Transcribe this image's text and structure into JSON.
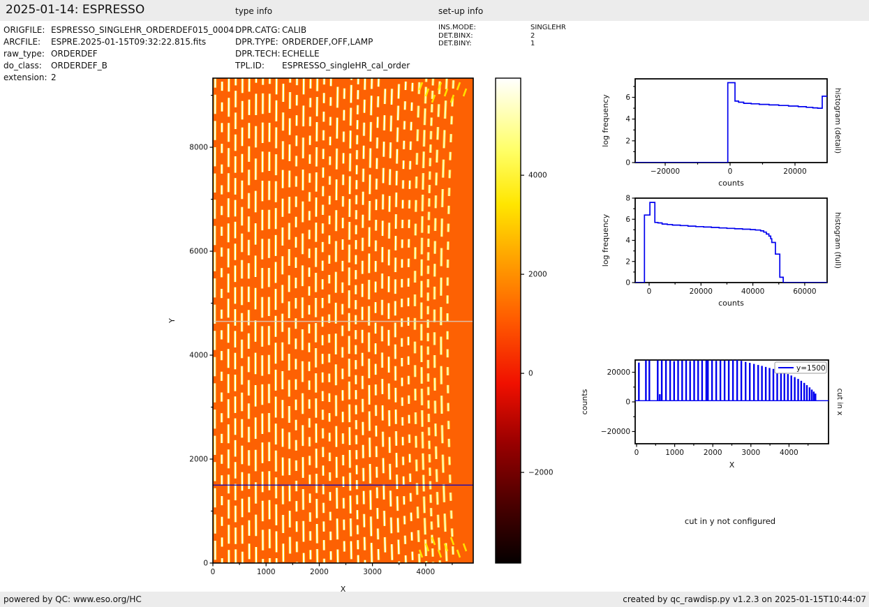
{
  "header": {
    "title": "2025-01-14: ESPRESSO",
    "type_info_label": "type info",
    "setup_info_label": "set-up info"
  },
  "metadata": {
    "rows": [
      {
        "label": "ORIGFILE:",
        "value": "ESPRESSO_SINGLEHR_ORDERDEF015_0004"
      },
      {
        "label": "ARCFILE:",
        "value": "ESPRE.2025-01-15T09:32:22.815.fits"
      },
      {
        "label": "raw_type:",
        "value": "ORDERDEF"
      },
      {
        "label": "do_class:",
        "value": "ORDERDEF_B"
      },
      {
        "label": "extension:",
        "value": "2"
      }
    ]
  },
  "type_info": {
    "rows": [
      {
        "label": "DPR.CATG:",
        "value": "CALIB"
      },
      {
        "label": "DPR.TYPE:",
        "value": "ORDERDEF,OFF,LAMP"
      },
      {
        "label": "DPR.TECH:",
        "value": "ECHELLE"
      },
      {
        "label": "TPL.ID:",
        "value": "ESPRESSO_singleHR_cal_order"
      }
    ]
  },
  "setup_info": {
    "rows": [
      {
        "label": "INS.MODE:",
        "value": "SINGLEHR"
      },
      {
        "label": "DET.BINX:",
        "value": "2"
      },
      {
        "label": "DET.BINY:",
        "value": "1"
      }
    ]
  },
  "notes": {
    "cut_in_y": "cut in y not configured"
  },
  "footer": {
    "left": "powered by QC: www.eso.org/HC",
    "right": "created by qc_rawdisp.py v1.2.3 on 2025-01-15T10:44:07"
  },
  "chart_data": [
    {
      "id": "main_image",
      "type": "heatmap",
      "xlabel": "X",
      "ylabel": "Y",
      "xlim": [
        0,
        4895
      ],
      "ylim": [
        0,
        9330
      ],
      "xticks": [
        {
          "v": 0,
          "l": "0"
        },
        {
          "v": 500
        },
        {
          "v": 1000,
          "l": "1000"
        },
        {
          "v": 1500
        },
        {
          "v": 2000,
          "l": "2000"
        },
        {
          "v": 2500
        },
        {
          "v": 3000,
          "l": "3000"
        },
        {
          "v": 3500
        },
        {
          "v": 4000,
          "l": "4000"
        },
        {
          "v": 4500
        }
      ],
      "yticks": [
        {
          "v": 0,
          "l": "0"
        },
        {
          "v": 1000
        },
        {
          "v": 2000,
          "l": "2000"
        },
        {
          "v": 3000
        },
        {
          "v": 4000,
          "l": "4000"
        },
        {
          "v": 5000
        },
        {
          "v": 6000,
          "l": "6000"
        },
        {
          "v": 7000
        },
        {
          "v": 8000,
          "l": "8000"
        },
        {
          "v": 9000
        }
      ],
      "bg_color": "#fd6103",
      "stripe_color": "#ffffff",
      "stripe_glow": "#ffd700",
      "stripe_count": 36,
      "stripe_x0": 45,
      "stripe_dx": 128,
      "cut_line_y": 1500,
      "cut_color": "#0000c8",
      "gap_line_y": 4650
    },
    {
      "id": "colorbar",
      "type": "colorbar",
      "vmin": -3830,
      "vmax": 5960,
      "ticks": [
        {
          "v": 4000,
          "l": "4000"
        },
        {
          "v": 2000,
          "l": "2000"
        },
        {
          "v": 0,
          "l": "0"
        },
        {
          "v": -2000,
          "l": "−2000"
        }
      ],
      "stops": [
        {
          "t": 0,
          "c": "#050000"
        },
        {
          "t": 0.12,
          "c": "#4a0000"
        },
        {
          "t": 0.25,
          "c": "#9b0000"
        },
        {
          "t": 0.37,
          "c": "#f01000"
        },
        {
          "t": 0.5,
          "c": "#ff5a00"
        },
        {
          "t": 0.62,
          "c": "#ff9e00"
        },
        {
          "t": 0.74,
          "c": "#ffe600"
        },
        {
          "t": 0.85,
          "c": "#ffff66"
        },
        {
          "t": 1,
          "c": "#ffffff"
        }
      ]
    },
    {
      "id": "hist_detail",
      "type": "step",
      "xlabel": "counts",
      "ylabel": "log frequency",
      "right_label": "histogram (detail)",
      "line_color": "#0000ee",
      "xlim": [
        -29250,
        29900
      ],
      "ylim": [
        0,
        7.7
      ],
      "xticks": [
        {
          "v": -20000,
          "l": "−20000"
        },
        {
          "v": -10000
        },
        {
          "v": 0,
          "l": "0"
        },
        {
          "v": 10000
        },
        {
          "v": 20000,
          "l": "20000"
        }
      ],
      "yticks": [
        {
          "v": 0,
          "l": "0"
        },
        {
          "v": 1
        },
        {
          "v": 2,
          "l": "2"
        },
        {
          "v": 3
        },
        {
          "v": 4,
          "l": "4"
        },
        {
          "v": 5
        },
        {
          "v": 6,
          "l": "6"
        },
        {
          "v": 7
        }
      ],
      "points": [
        [
          -29250,
          0
        ],
        [
          -700,
          0
        ],
        [
          -700,
          7.35
        ],
        [
          1500,
          7.35
        ],
        [
          1500,
          5.65
        ],
        [
          2600,
          5.55
        ],
        [
          4200,
          5.45
        ],
        [
          6500,
          5.4
        ],
        [
          9000,
          5.35
        ],
        [
          12000,
          5.3
        ],
        [
          15000,
          5.25
        ],
        [
          18000,
          5.2
        ],
        [
          21000,
          5.14
        ],
        [
          23500,
          5.08
        ],
        [
          25500,
          5.03
        ],
        [
          27000,
          5.0
        ],
        [
          28400,
          5.0
        ],
        [
          28400,
          6.1
        ],
        [
          29900,
          6.1
        ]
      ]
    },
    {
      "id": "hist_full",
      "type": "step",
      "xlabel": "counts",
      "ylabel": "log frequency",
      "right_label": "histogram (full)",
      "line_color": "#0000ee",
      "xlim": [
        -5380,
        68640
      ],
      "ylim": [
        0,
        8
      ],
      "xticks": [
        {
          "v": 0,
          "l": "0"
        },
        {
          "v": 10000
        },
        {
          "v": 20000,
          "l": "20000"
        },
        {
          "v": 30000
        },
        {
          "v": 40000,
          "l": "40000"
        },
        {
          "v": 50000
        },
        {
          "v": 60000,
          "l": "60000"
        }
      ],
      "yticks": [
        {
          "v": 0,
          "l": "0"
        },
        {
          "v": 1
        },
        {
          "v": 2,
          "l": "2"
        },
        {
          "v": 3
        },
        {
          "v": 4,
          "l": "4"
        },
        {
          "v": 5
        },
        {
          "v": 6,
          "l": "6"
        },
        {
          "v": 7
        },
        {
          "v": 8,
          "l": "8"
        }
      ],
      "points": [
        [
          -5380,
          0
        ],
        [
          -1800,
          0
        ],
        [
          -1800,
          6.4
        ],
        [
          300,
          6.4
        ],
        [
          300,
          7.6
        ],
        [
          2200,
          7.6
        ],
        [
          2200,
          5.7
        ],
        [
          3400,
          5.65
        ],
        [
          5000,
          5.55
        ],
        [
          7000,
          5.5
        ],
        [
          9000,
          5.45
        ],
        [
          12000,
          5.4
        ],
        [
          15000,
          5.35
        ],
        [
          18000,
          5.3
        ],
        [
          21000,
          5.26
        ],
        [
          24000,
          5.22
        ],
        [
          27000,
          5.18
        ],
        [
          30000,
          5.14
        ],
        [
          33000,
          5.1
        ],
        [
          36000,
          5.06
        ],
        [
          39000,
          5.02
        ],
        [
          41000,
          4.98
        ],
        [
          43000,
          4.9
        ],
        [
          44200,
          4.78
        ],
        [
          45200,
          4.6
        ],
        [
          46200,
          4.4
        ],
        [
          46900,
          4.15
        ],
        [
          47300,
          3.8
        ],
        [
          48700,
          2.7
        ],
        [
          50400,
          0.5
        ],
        [
          51700,
          0
        ],
        [
          68640,
          0
        ]
      ]
    },
    {
      "id": "cut_x",
      "type": "spikes",
      "xlabel": "X",
      "ylabel": "counts",
      "right_label": "cut in x",
      "legend": "y=1500",
      "line_color": "#0000ee",
      "xlim": [
        -37,
        5037
      ],
      "ylim": [
        -28250,
        28250
      ],
      "baseline": 800,
      "xticks": [
        {
          "v": 0,
          "l": "0"
        },
        {
          "v": 500
        },
        {
          "v": 1000,
          "l": "1000"
        },
        {
          "v": 1500
        },
        {
          "v": 2000,
          "l": "2000"
        },
        {
          "v": 2500
        },
        {
          "v": 3000,
          "l": "3000"
        },
        {
          "v": 3500
        },
        {
          "v": 4000,
          "l": "4000"
        },
        {
          "v": 4500
        }
      ],
      "yticks": [
        {
          "v": -20000,
          "l": "−20000"
        },
        {
          "v": -10000
        },
        {
          "v": 0,
          "l": "0"
        },
        {
          "v": 10000
        },
        {
          "v": 20000,
          "l": "20000"
        }
      ],
      "spikes": [
        [
          60,
          26500
        ],
        [
          245,
          28000
        ],
        [
          335,
          28000
        ],
        [
          555,
          28000
        ],
        [
          610,
          5200
        ],
        [
          660,
          28000
        ],
        [
          770,
          28000
        ],
        [
          880,
          28000
        ],
        [
          985,
          27500
        ],
        [
          1090,
          28000
        ],
        [
          1195,
          27800
        ],
        [
          1300,
          28000
        ],
        [
          1405,
          27600
        ],
        [
          1510,
          28000
        ],
        [
          1615,
          27800
        ],
        [
          1720,
          28000
        ],
        [
          1830,
          27900
        ],
        [
          1872,
          27900
        ],
        [
          1980,
          28000
        ],
        [
          2090,
          27700
        ],
        [
          2200,
          27900
        ],
        [
          2310,
          27800
        ],
        [
          2420,
          28000
        ],
        [
          2530,
          28200
        ],
        [
          2640,
          28300
        ],
        [
          2750,
          27700
        ],
        [
          2860,
          27000
        ],
        [
          2970,
          26300
        ],
        [
          3080,
          25600
        ],
        [
          3190,
          24900
        ],
        [
          3290,
          24300
        ],
        [
          3390,
          23600
        ],
        [
          3490,
          22900
        ],
        [
          3590,
          22200
        ],
        [
          3690,
          21400
        ],
        [
          3790,
          20600
        ],
        [
          3880,
          19700
        ],
        [
          3970,
          18800
        ],
        [
          4060,
          17800
        ],
        [
          4150,
          16700
        ],
        [
          4240,
          15500
        ],
        [
          4320,
          14200
        ],
        [
          4400,
          12800
        ],
        [
          4470,
          11300
        ],
        [
          4540,
          9800
        ],
        [
          4600,
          8300
        ],
        [
          4650,
          6900
        ],
        [
          4695,
          5600
        ]
      ]
    }
  ]
}
